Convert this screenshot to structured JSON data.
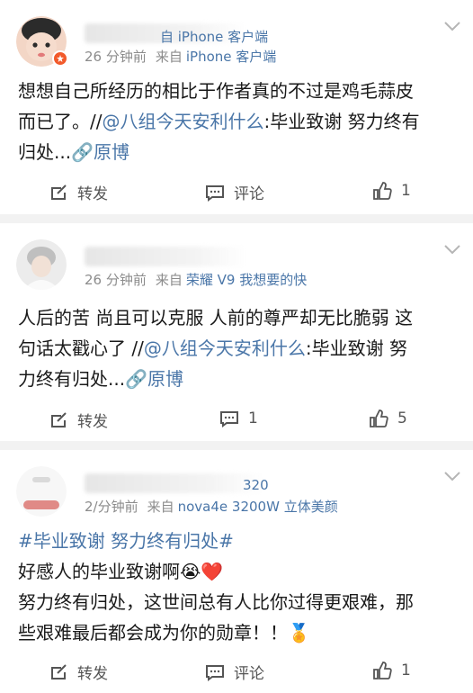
{
  "posts": [
    {
      "time": "26 分钟前",
      "source_prefix": "来自",
      "source": "iPhone 客户端",
      "name_ghost": "自 iPhone 客户端",
      "content": {
        "line1": "想想自己所经历的相比于作者真的不过是鸡毛蒜皮",
        "line2_text": "而已了。//",
        "line2_mention": "@八组今天安利什么",
        "line2_rest": ":毕业致谢 努力终有",
        "line3_text": "归处...",
        "line3_link": "🔗原博"
      },
      "actions": {
        "repost": "转发",
        "comment": "评论",
        "like_count": "1"
      }
    },
    {
      "time": "26 分钟前",
      "source_prefix": "来自",
      "source": "荣耀 V9 我想要的快",
      "content": {
        "line1": "人后的苦 尚且可以克服 人前的尊严却无比脆弱 这",
        "line2_text": "句话太戳心了 //",
        "line2_mention": "@八组今天安利什么",
        "line2_rest": ":毕业致谢 努",
        "line3_text": "力终有归处...",
        "line3_link": "🔗原博"
      },
      "actions": {
        "repost": "转发",
        "comment_count": "1",
        "like_count": "5"
      }
    },
    {
      "time": "2/分钟前",
      "source_prefix": "来自",
      "source": "nova4e 3200W 立体美颜",
      "name_ghost": "320",
      "content": {
        "line1_tag": "#毕业致谢 努力终有归处#",
        "line2": "好感人的毕业致谢啊",
        "line2_emoji": "😭❤️",
        "line3": "努力终有归处，这世间总有人比你过得更艰难，那",
        "line4": "些艰难最后都会成为你的勋章！！",
        "line4_emoji": "🏅"
      },
      "actions": {
        "repost": "转发",
        "comment": "评论",
        "like_count": "1"
      }
    }
  ],
  "colors": {
    "link": "#4a76a8",
    "meta": "#8c8c8c",
    "text": "#1a1a1a",
    "badge": "#f25a2b",
    "bg": "#f2f2f2"
  },
  "icons": [
    "repost-icon",
    "comment-icon",
    "like-icon",
    "chevron-down-icon",
    "verified-badge-icon"
  ]
}
